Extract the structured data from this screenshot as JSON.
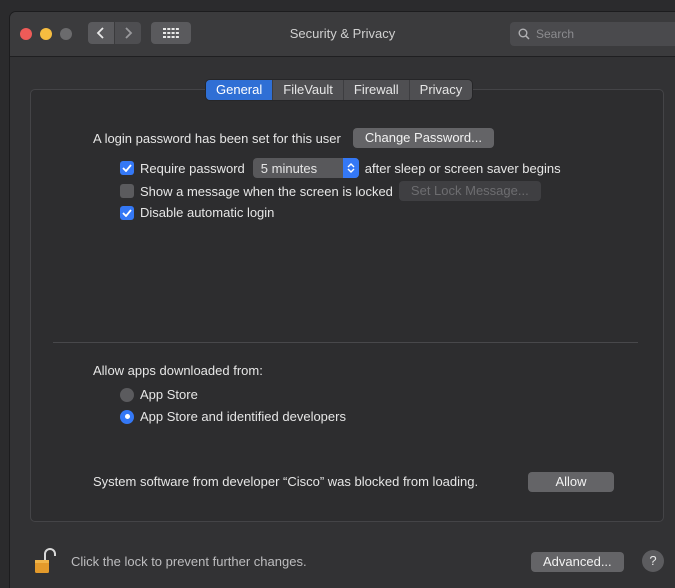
{
  "window": {
    "title": "Security & Privacy"
  },
  "search": {
    "placeholder": "Search"
  },
  "tabs": [
    {
      "label": "General",
      "active": true
    },
    {
      "label": "FileVault",
      "active": false
    },
    {
      "label": "Firewall",
      "active": false
    },
    {
      "label": "Privacy",
      "active": false
    }
  ],
  "general": {
    "login_text": "A login password has been set for this user",
    "change_password": "Change Password...",
    "require_password": {
      "label": "Require password",
      "checked": true,
      "value": "5 minutes",
      "suffix": "after sleep or screen saver begins"
    },
    "show_message": {
      "label": "Show a message when the screen is locked",
      "checked": false,
      "button": "Set Lock Message..."
    },
    "disable_autologin": {
      "label": "Disable automatic login",
      "checked": true
    }
  },
  "downloads": {
    "heading": "Allow apps downloaded from:",
    "options": [
      {
        "label": "App Store",
        "selected": false
      },
      {
        "label": "App Store and identified developers",
        "selected": true
      }
    ]
  },
  "blocked": {
    "text": "System software from developer “Cisco” was blocked from loading.",
    "button": "Allow"
  },
  "footer": {
    "lock_text": "Click the lock to prevent further changes.",
    "advanced": "Advanced...",
    "help": "?"
  },
  "colors": {
    "accent": "#3478f6",
    "close": "#ee5b58",
    "minimize": "#f6bd40",
    "lock": "#e39a2b"
  }
}
